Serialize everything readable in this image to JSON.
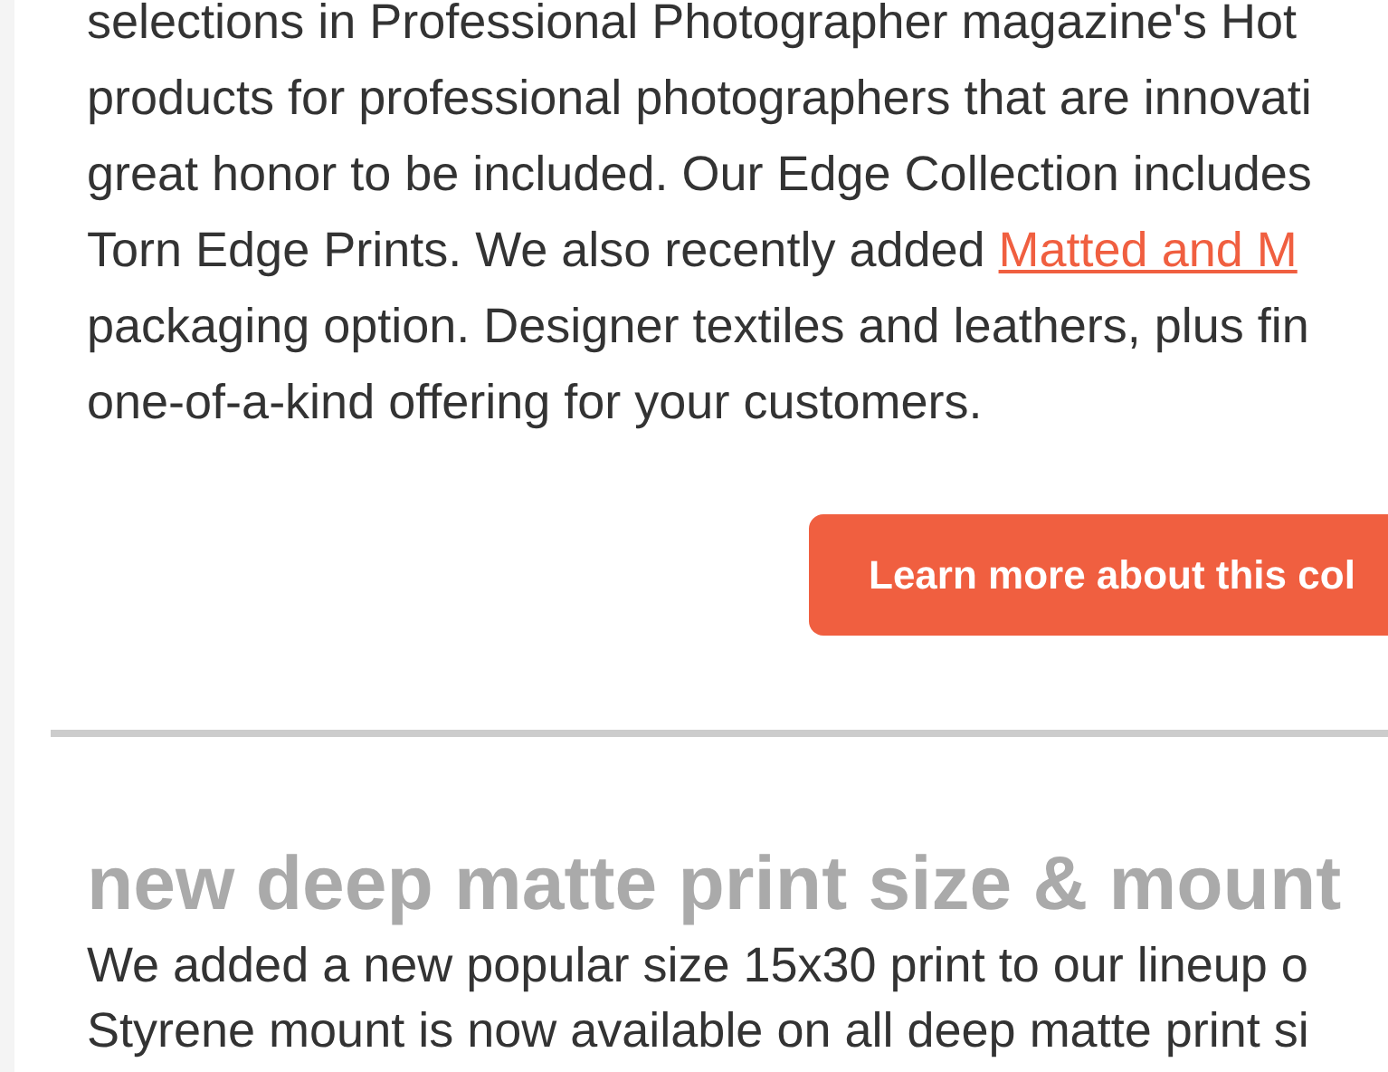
{
  "article_1": {
    "lines": [
      {
        "text": "selections in Professional Photographer magazine's Hot"
      },
      {
        "text": "products for professional photographers that are innovati"
      },
      {
        "text": "great honor to be included. Our Edge Collection includes"
      },
      {
        "text": "Torn Edge Prints. We also recently added ",
        "link": "Matted and M"
      },
      {
        "text": "packaging option. Designer textiles and leathers, plus fin"
      },
      {
        "text": "one-of-a-kind offering for your customers."
      }
    ],
    "button": "Learn more about this col"
  },
  "article_2": {
    "heading": "new deep matte print size & mount",
    "lines": [
      {
        "text": "We added a new popular size 15x30 print to our lineup o"
      },
      {
        "text": "Styrene mount is now available on all deep matte print si"
      }
    ]
  }
}
